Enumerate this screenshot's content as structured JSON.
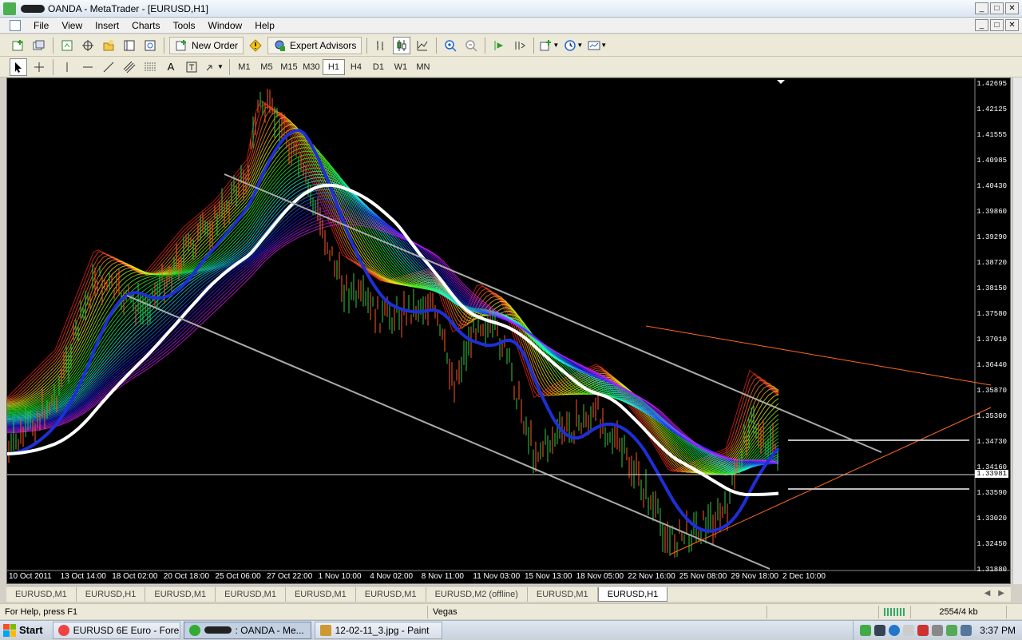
{
  "window": {
    "title": "OANDA - MetaTrader - [EURUSD,H1]",
    "controls": [
      "_",
      "□",
      "✕"
    ]
  },
  "menu": {
    "items": [
      "File",
      "View",
      "Insert",
      "Charts",
      "Tools",
      "Window",
      "Help"
    ]
  },
  "toolbar": {
    "new_order_label": "New Order",
    "expert_advisors_label": "Expert Advisors"
  },
  "timeframes": [
    "M1",
    "M5",
    "M15",
    "M30",
    "H1",
    "H4",
    "D1",
    "W1",
    "MN"
  ],
  "active_timeframe": "H1",
  "chart": {
    "symbol": "EURUSD,H1",
    "price_labels": [
      "1.42695",
      "1.42125",
      "1.41555",
      "1.40985",
      "1.40430",
      "1.39860",
      "1.39290",
      "1.38720",
      "1.38150",
      "1.37580",
      "1.37010",
      "1.36440",
      "1.35870",
      "1.35300",
      "1.34730",
      "1.34160",
      "1.33590",
      "1.33020",
      "1.32450",
      "1.31880"
    ],
    "current_price": "1.33981",
    "date_labels": [
      "10 Oct 2011",
      "13 Oct 14:00",
      "18 Oct 02:00",
      "20 Oct 18:00",
      "25 Oct 06:00",
      "27 Oct 22:00",
      "1 Nov 10:00",
      "4 Nov 02:00",
      "8 Nov 11:00",
      "11 Nov 03:00",
      "15 Nov 13:00",
      "18 Nov 05:00",
      "22 Nov 16:00",
      "25 Nov 08:00",
      "29 Nov 18:00",
      "2 Dec 10:00"
    ],
    "background": "#000000"
  },
  "tabs": [
    "EURUSD,M1",
    "EURUSD,H1",
    "EURUSD,M1",
    "EURUSD,M1",
    "EURUSD,M1",
    "EURUSD,M1",
    "EURUSD,M2 (offline)",
    "EURUSD,M1",
    "EURUSD,H1"
  ],
  "active_tab_index": 8,
  "status": {
    "help": "For Help, press F1",
    "profile": "Vegas",
    "traffic": "2554/4 kb"
  },
  "taskbar": {
    "start_label": "Start",
    "tasks": [
      "EURUSD 6E Euro - Fore...",
      ": OANDA - Me...",
      "12-02-11_3.jpg - Paint"
    ],
    "active_task_index": 1,
    "clock": "3:37 PM"
  }
}
